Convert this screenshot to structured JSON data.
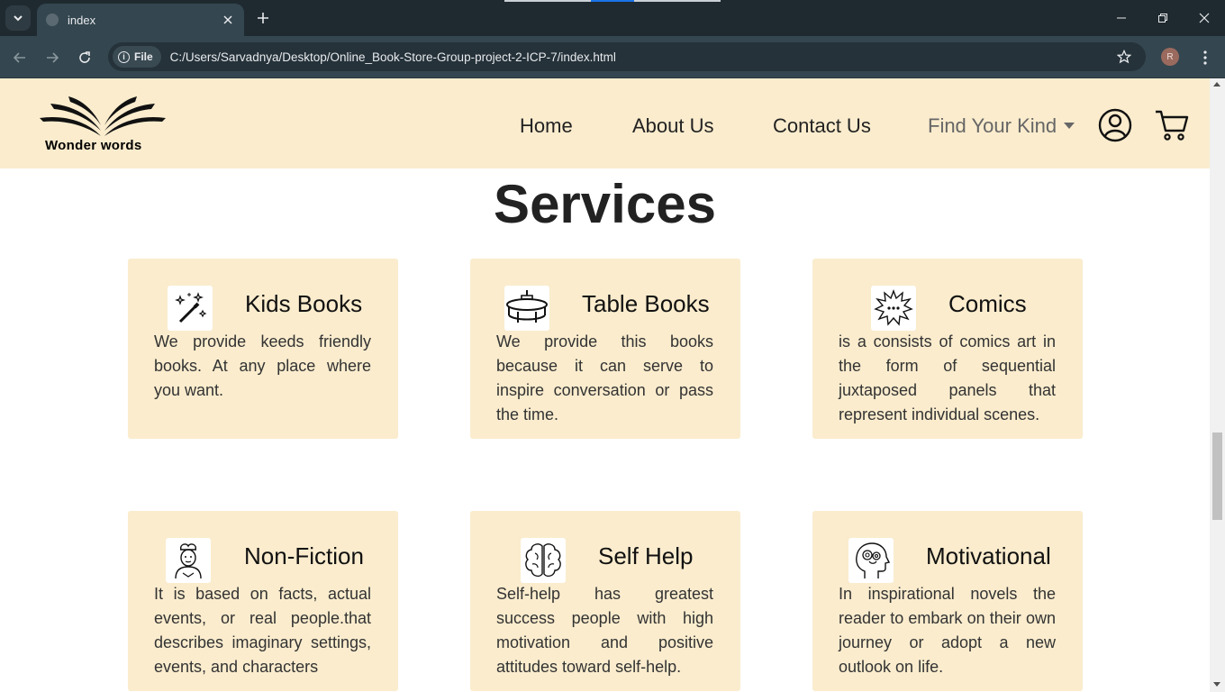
{
  "browser": {
    "tab_title": "index",
    "file_label": "File",
    "url": "C:/Users/Sarvadnya/Desktop/Online_Book-Store-Group-project-2-ICP-7/index.html",
    "profile_initial": "R"
  },
  "header": {
    "logo_text": "Wonder words",
    "nav": [
      {
        "label": "Home"
      },
      {
        "label": "About Us"
      },
      {
        "label": "Contact Us"
      },
      {
        "label": "Find Your Kind"
      }
    ]
  },
  "services": {
    "title": "Services",
    "cards": [
      {
        "title": "Kids Books",
        "icon": "magic-wand-icon",
        "text": "We provide keeds friendly books. At any place where you want."
      },
      {
        "title": "Table Books",
        "icon": "table-icon",
        "text": "We provide this books because it can serve to inspire conversation or pass the time."
      },
      {
        "title": "Comics",
        "icon": "comic-burst-icon",
        "text": "is a consists of comics art in the form of sequential juxtaposed panels that represent individual scenes."
      },
      {
        "title": "Non-Fiction",
        "icon": "thinking-person-icon",
        "text": "It is based on facts, actual events, or real people.that describes imaginary settings, events, and characters"
      },
      {
        "title": "Self Help",
        "icon": "brain-icon",
        "text": "Self-help has greatest success people with high motivation and positive attitudes toward self-help."
      },
      {
        "title": "Motivational",
        "icon": "head-gears-icon",
        "text": "In inspirational novels the reader to embark on their own journey or adopt a new outlook on life."
      }
    ]
  }
}
